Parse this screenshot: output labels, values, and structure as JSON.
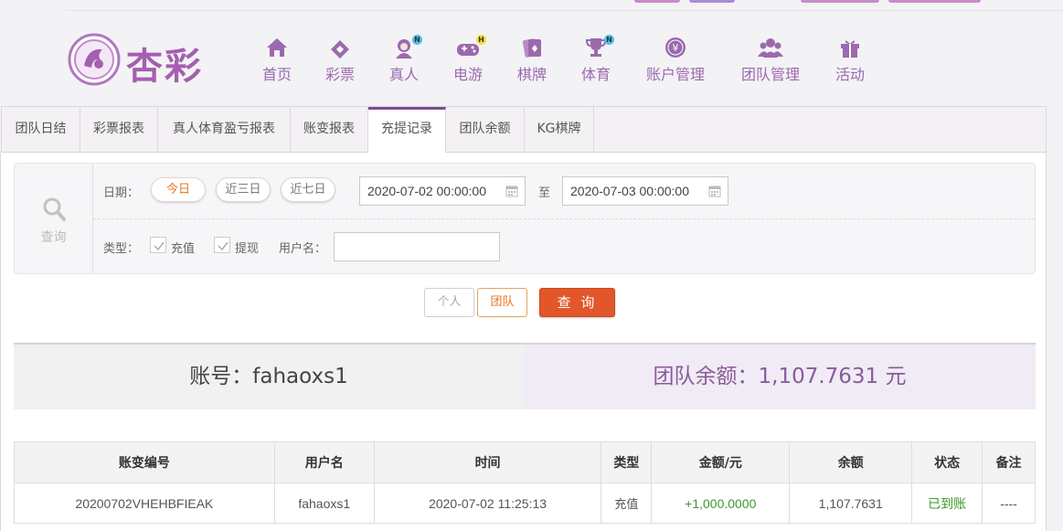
{
  "colors": {
    "brand": "#9b6aad",
    "accent": "#e2562a",
    "success": "#3a9a28"
  },
  "logo": {
    "text": "杏彩"
  },
  "nav": [
    {
      "label": "首页",
      "icon": "home-icon"
    },
    {
      "label": "彩票",
      "icon": "ticket-icon"
    },
    {
      "label": "真人",
      "icon": "dealer-icon",
      "badge": "N"
    },
    {
      "label": "电游",
      "icon": "gamepad-icon",
      "badge": "H"
    },
    {
      "label": "棋牌",
      "icon": "cards-icon"
    },
    {
      "label": "体育",
      "icon": "trophy-icon",
      "badge": "N"
    },
    {
      "label": "账户管理",
      "icon": "yen-coin-icon"
    },
    {
      "label": "团队管理",
      "icon": "team-icon"
    },
    {
      "label": "活动",
      "icon": "gift-icon"
    }
  ],
  "tabs": [
    {
      "label": "团队日结"
    },
    {
      "label": "彩票报表"
    },
    {
      "label": "真人体育盈亏报表"
    },
    {
      "label": "账变报表"
    },
    {
      "label": "充提记录",
      "active": true
    },
    {
      "label": "团队余额"
    },
    {
      "label": "KG棋牌"
    }
  ],
  "search": {
    "side_label": "查询",
    "date_label": "日期：",
    "quick_ranges": [
      "今日",
      "近三日",
      "近七日"
    ],
    "active_range": "今日",
    "start_date": "2020-07-02 00:00:00",
    "to_label": "至",
    "end_date": "2020-07-03 00:00:00",
    "type_label": "类型：",
    "types": [
      {
        "label": "充值",
        "checked": true
      },
      {
        "label": "提现",
        "checked": true
      }
    ],
    "username_label": "用户名：",
    "username_value": ""
  },
  "buttons": {
    "personal": "个人",
    "team": "团队",
    "query": "查 询"
  },
  "summary": {
    "account": "账号：fahaoxs1",
    "team_balance": "团队余额：1,107.7631 元"
  },
  "table": {
    "headers": [
      "账变编号",
      "用户名",
      "时间",
      "类型",
      "金额/元",
      "余额",
      "状态",
      "备注"
    ],
    "rows": [
      {
        "id": "20200702VHEHBFIEAK",
        "user": "fahaoxs1",
        "time": "2020-07-02 11:25:13",
        "type": "充值",
        "amount": "+1,000.0000",
        "balance": "1,107.7631",
        "status": "已到账",
        "remark": "----"
      }
    ]
  }
}
